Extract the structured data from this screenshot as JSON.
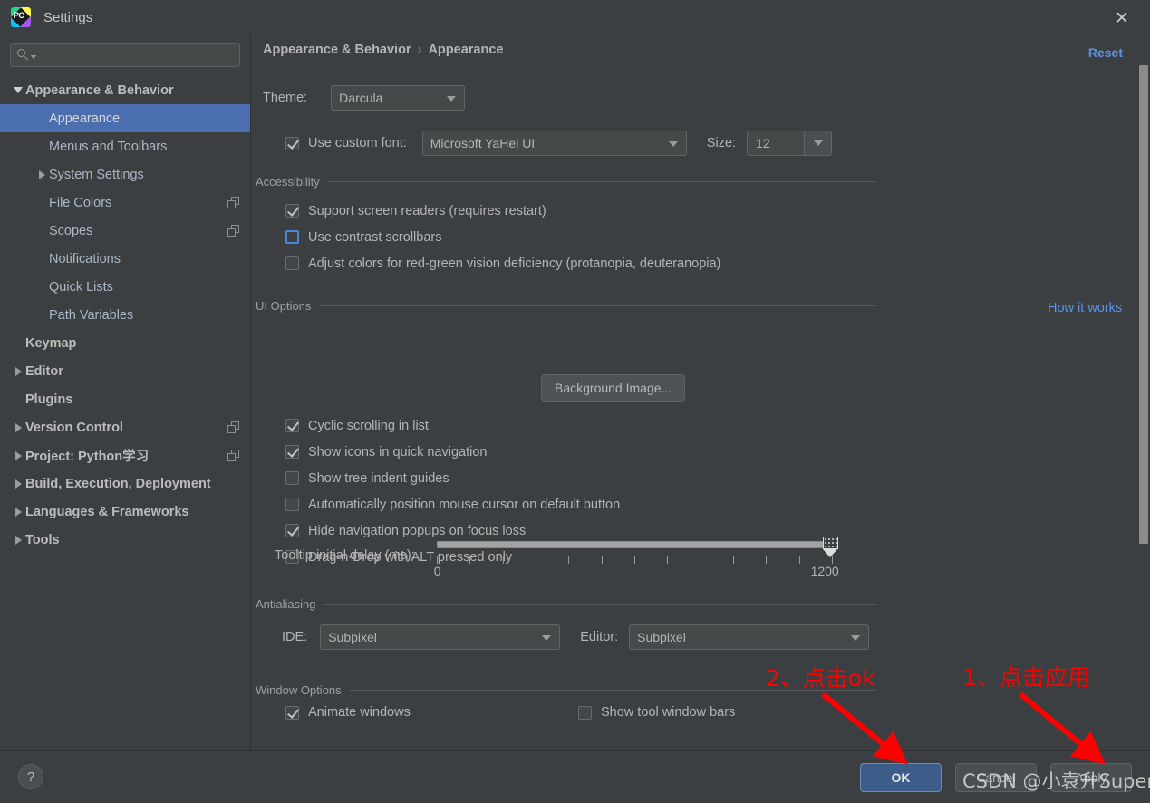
{
  "window": {
    "title": "Settings",
    "app_icon": "pycharm-icon",
    "close_icon": "close-icon"
  },
  "sidebar": {
    "search": {
      "placeholder": "",
      "value": "",
      "icon": "search-icon"
    },
    "items": [
      {
        "label": "Appearance & Behavior",
        "indent": 0,
        "arrow": "down",
        "bold": true,
        "selected": false,
        "copy": false
      },
      {
        "label": "Appearance",
        "indent": 1,
        "arrow": "none",
        "bold": false,
        "selected": true,
        "copy": false
      },
      {
        "label": "Menus and Toolbars",
        "indent": 1,
        "arrow": "none",
        "bold": false,
        "selected": false,
        "copy": false
      },
      {
        "label": "System Settings",
        "indent": 1,
        "arrow": "right",
        "bold": false,
        "selected": false,
        "copy": false
      },
      {
        "label": "File Colors",
        "indent": 1,
        "arrow": "none",
        "bold": false,
        "selected": false,
        "copy": true
      },
      {
        "label": "Scopes",
        "indent": 1,
        "arrow": "none",
        "bold": false,
        "selected": false,
        "copy": true
      },
      {
        "label": "Notifications",
        "indent": 1,
        "arrow": "none",
        "bold": false,
        "selected": false,
        "copy": false
      },
      {
        "label": "Quick Lists",
        "indent": 1,
        "arrow": "none",
        "bold": false,
        "selected": false,
        "copy": false
      },
      {
        "label": "Path Variables",
        "indent": 1,
        "arrow": "none",
        "bold": false,
        "selected": false,
        "copy": false
      },
      {
        "label": "Keymap",
        "indent": 0,
        "arrow": "none",
        "bold": true,
        "selected": false,
        "copy": false
      },
      {
        "label": "Editor",
        "indent": 0,
        "arrow": "right",
        "bold": true,
        "selected": false,
        "copy": false
      },
      {
        "label": "Plugins",
        "indent": 0,
        "arrow": "none",
        "bold": true,
        "selected": false,
        "copy": false
      },
      {
        "label": "Version Control",
        "indent": 0,
        "arrow": "right",
        "bold": true,
        "selected": false,
        "copy": true
      },
      {
        "label": "Project: Python学习",
        "indent": 0,
        "arrow": "right",
        "bold": true,
        "selected": false,
        "copy": true
      },
      {
        "label": "Build, Execution, Deployment",
        "indent": 0,
        "arrow": "right",
        "bold": true,
        "selected": false,
        "copy": false
      },
      {
        "label": "Languages & Frameworks",
        "indent": 0,
        "arrow": "right",
        "bold": true,
        "selected": false,
        "copy": false
      },
      {
        "label": "Tools",
        "indent": 0,
        "arrow": "right",
        "bold": true,
        "selected": false,
        "copy": false
      }
    ]
  },
  "main": {
    "breadcrumb": {
      "parent": "Appearance & Behavior",
      "separator": "›",
      "current": "Appearance"
    },
    "reset_label": "Reset",
    "theme": {
      "label": "Theme:",
      "value": "Darcula"
    },
    "custom_font": {
      "checkbox_label": "Use custom font:",
      "checked": true,
      "value": "Microsoft YaHei UI",
      "size_label": "Size:",
      "size_value": "12"
    },
    "accessibility": {
      "title": "Accessibility",
      "options": [
        {
          "label": "Support screen readers (requires restart)",
          "checked": true,
          "focused": false
        },
        {
          "label": "Use contrast scrollbars",
          "checked": false,
          "focused": true
        },
        {
          "label": "Adjust colors for red-green vision deficiency (protanopia, deuteranopia)",
          "checked": false,
          "focused": false
        }
      ],
      "link_label": "How it works"
    },
    "ui_options": {
      "title": "UI Options",
      "background_image_button": "Background Image...",
      "options": [
        {
          "label": "Cyclic scrolling in list",
          "checked": true
        },
        {
          "label": "Show icons in quick navigation",
          "checked": true
        },
        {
          "label": "Show tree indent guides",
          "checked": false
        },
        {
          "label": "Automatically position mouse cursor on default button",
          "checked": false
        },
        {
          "label": "Hide navigation popups on focus loss",
          "checked": true
        },
        {
          "label": "Drag-n-Drop with ALT pressed only",
          "checked": false
        }
      ],
      "slider": {
        "label": "Tooltip initial delay (ms):",
        "min_label": "0",
        "max_label": "1200",
        "value": 1200,
        "min": 0,
        "max": 1200,
        "tick_count": 13
      }
    },
    "antialiasing": {
      "title": "Antialiasing",
      "ide_label": "IDE:",
      "ide_value": "Subpixel",
      "editor_label": "Editor:",
      "editor_value": "Subpixel"
    },
    "window_options": {
      "title": "Window Options",
      "options": [
        {
          "label": "Animate windows",
          "checked": true
        },
        {
          "label": "Show tool window bars",
          "checked": false
        }
      ]
    }
  },
  "footer": {
    "help_label": "?",
    "ok_label": "OK",
    "cancel_label": "Cancel",
    "apply_label": "Apply"
  },
  "annotations": {
    "ok_note": "2、点击ok",
    "apply_note": "1、点击应用",
    "color": "#fe0000",
    "watermark": "CSDN @小袁升Super"
  }
}
